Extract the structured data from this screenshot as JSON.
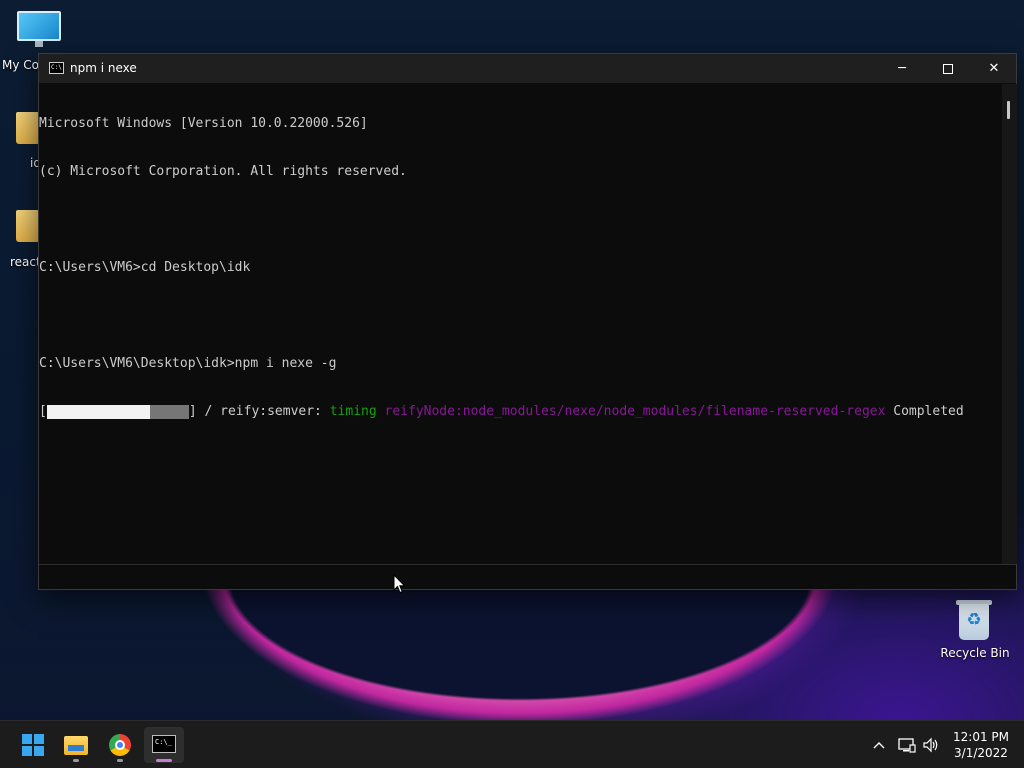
{
  "desktop": {
    "icons": [
      {
        "label": "My Co"
      },
      {
        "label": "id"
      },
      {
        "label": "react"
      },
      {
        "label": "Recycle Bin"
      }
    ]
  },
  "window": {
    "title": "npm i nexe",
    "lines": [
      "Microsoft Windows [Version 10.0.22000.526]",
      "(c) Microsoft Corporation. All rights reserved.",
      "",
      "C:\\Users\\VM6>cd Desktop\\idk",
      "",
      "C:\\Users\\VM6\\Desktop\\idk>npm i nexe -g"
    ],
    "progress": {
      "open": "[",
      "close": "]",
      "fraction": 0.73,
      "spinner": " / ",
      "stage": "reify:semver: ",
      "timing": "timing ",
      "node": "reifyNode:node_modules/nexe/node_modules/filename-reserved-regex",
      "status": " Completed"
    }
  },
  "taskbar": {
    "items": [
      "start-icon",
      "file-explorer-icon",
      "chrome-icon",
      "command-prompt-icon"
    ],
    "tray": {
      "chevron": "^",
      "time": "12:01 PM",
      "date": "3/1/2022"
    }
  },
  "colors": {
    "accent_active": "#c77dd6",
    "console_bg": "#0c0c0c",
    "console_fg": "#cccccc",
    "timing_green": "#13a10e",
    "node_magenta": "#881798"
  }
}
